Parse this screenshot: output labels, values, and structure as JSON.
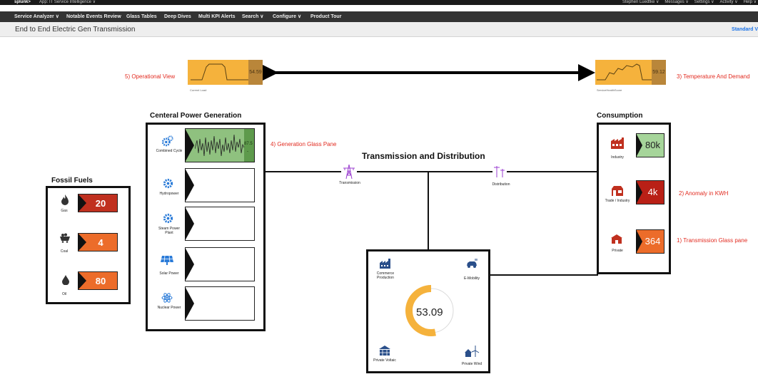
{
  "topbar": {
    "logo": "splunk>",
    "app": "App: IT Service Intelligence ∨",
    "user": "Stephen Luedtke ∨",
    "messages": "Messages ∨",
    "settings": "Settings ∨",
    "activity": "Activity ∨",
    "help": "Help ∨"
  },
  "nav": {
    "service_analyzer": "Service Analyzer ∨",
    "notable_events": "Notable Events Review",
    "glass_tables": "Glass Tables",
    "deep_dives": "Deep Dives",
    "multi_kpi": "Multi KPI Alerts",
    "search": "Search ∨",
    "configure": "Configure ∨",
    "product_tour": "Product Tour"
  },
  "page": {
    "title": "End to End Electric Gen Transmission",
    "view_mode": "Standard V"
  },
  "annotations": {
    "operational_view": "5) Operational View",
    "temperature_demand": "3) Temperature And Demand",
    "generation_pane": "4) Generation Glass Pane",
    "anomaly": "2) Anomaly in KWH",
    "transmission_pane": "1) Transmission Glass pane"
  },
  "top_sparks": {
    "left": {
      "value": "54.59",
      "caption": "Current Load"
    },
    "right": {
      "value": "59.12",
      "caption": "ServiceHealthScore"
    }
  },
  "fossil": {
    "title": "Fossil Fuels",
    "items": [
      {
        "label": "Gas",
        "value": "20",
        "color": "#c0301f"
      },
      {
        "label": "Coal",
        "value": "4",
        "color": "#ec6c2a"
      },
      {
        "label": "Oil",
        "value": "80",
        "color": "#ec6c2a"
      }
    ]
  },
  "central": {
    "title": "Centeral Power Generation",
    "items": [
      {
        "label": "Combined Cycle",
        "value": "87.5",
        "sub": "-"
      },
      {
        "label": "Hydropower"
      },
      {
        "label": "Steam Power Plant"
      },
      {
        "label": "Solar Power"
      },
      {
        "label": "Nuclear Power"
      }
    ]
  },
  "tnd": {
    "title": "Transmission and Distribution",
    "transmission": "Transmission",
    "distribution": "Distribution"
  },
  "consumption": {
    "title": "Consumption",
    "items": [
      {
        "label": "Industry",
        "value": "80k",
        "bg": "#a6d59a",
        "fg": "#222222"
      },
      {
        "label": "Trade / Industry",
        "value": "4k",
        "bg": "#b92016",
        "fg": "#ffffff"
      },
      {
        "label": "Private",
        "value": "364",
        "bg": "#ec6c2a",
        "fg": "#ffffff"
      }
    ]
  },
  "hub": {
    "commerce": "Commerce Production",
    "emobility": "E-Mobility",
    "private_voltaic": "Private Voltaic",
    "private_wind": "Private Wind",
    "gauge_value": "53.09",
    "gauge_fraction": 0.5309,
    "gauge_color": "#f5b23c"
  }
}
